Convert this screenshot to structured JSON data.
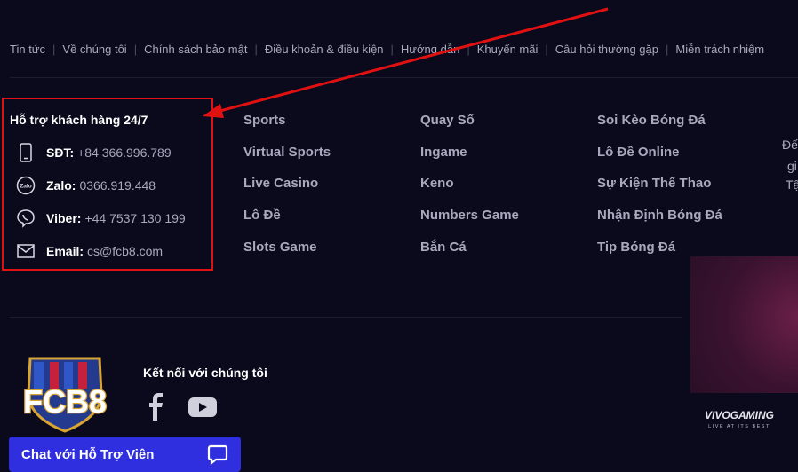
{
  "top_nav": [
    {
      "label": "Tin tức"
    },
    {
      "label": "Về chúng tôi"
    },
    {
      "label": "Chính sách bảo mật"
    },
    {
      "label": "Điều khoản & điều kiện"
    },
    {
      "label": "Hướng dẫn"
    },
    {
      "label": "Khuyến mãi"
    },
    {
      "label": "Câu hỏi thường gặp"
    },
    {
      "label": "Miễn trách nhiệm"
    }
  ],
  "support": {
    "title": "Hỗ trợ khách hàng 24/7",
    "contacts": [
      {
        "icon": "phone-icon",
        "key": "SĐT:",
        "value": "+84 366.996.789"
      },
      {
        "icon": "zalo-icon",
        "icon_text": "Zalo",
        "key": "Zalo:",
        "value": "0366.919.448"
      },
      {
        "icon": "viber-icon",
        "key": "Viber:",
        "value": "+44 7537 130 199"
      },
      {
        "icon": "email-icon",
        "key": "Email:",
        "value": "cs@fcb8.com"
      }
    ]
  },
  "link_columns": [
    [
      "Sports",
      "Virtual Sports",
      "Live Casino",
      "Lô Đề",
      "Slots Game"
    ],
    [
      "Quay Số",
      "Ingame",
      "Keno",
      "Numbers Game",
      "Bắn Cá"
    ],
    [
      "Soi Kèo Bóng Đá",
      "Lô Đề Online",
      "Sự Kiện Thể Thao",
      "Nhận Định Bóng Đá",
      "Tip Bóng Đá"
    ]
  ],
  "truncated_text": [
    "Đế",
    "gi",
    "Tậ"
  ],
  "brand": {
    "logo_text": "FCB8"
  },
  "partner": {
    "name": "VIVOGAMING",
    "tagline": "LIVE AT ITS BEST"
  },
  "connect": {
    "title": "Kết nối với chúng tôi",
    "socials": [
      "facebook-icon",
      "youtube-icon"
    ]
  },
  "chat": {
    "label": "Chat với Hỗ Trợ Viên",
    "icon": "chat-bubble-icon"
  },
  "colors": {
    "background": "#0b0a1c",
    "highlight": "#e21111",
    "chat_button": "#2f2fe0"
  }
}
